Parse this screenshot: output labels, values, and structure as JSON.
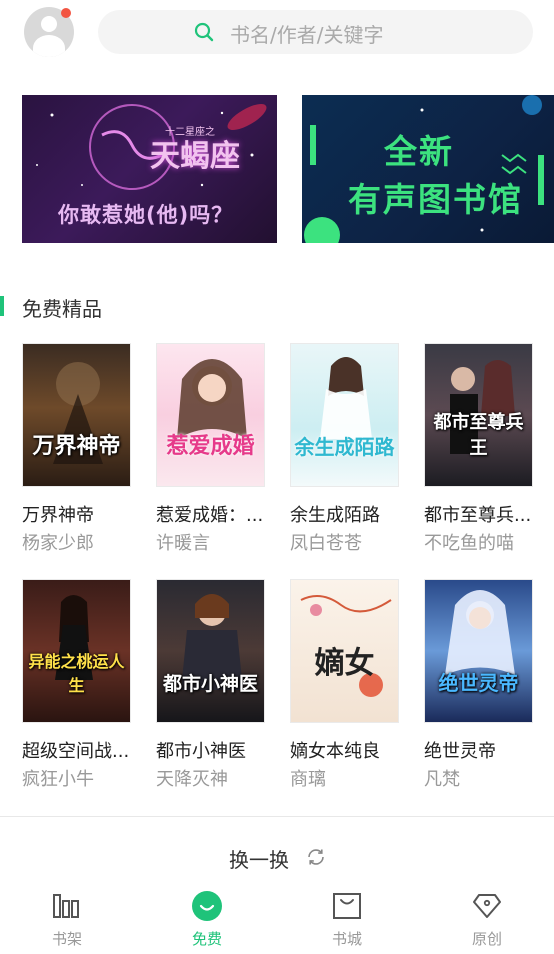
{
  "header": {
    "search_placeholder": "书名/作者/关键字"
  },
  "banners": [
    {
      "small": "十二星座之",
      "title": "天蝎座",
      "subtitle": "你敢惹她(他)吗？"
    },
    {
      "line1": "全新",
      "line2": "有声图书馆"
    }
  ],
  "section": {
    "title": "免费精品"
  },
  "books": [
    {
      "name": "万界神帝",
      "author": "杨家少郎",
      "cover_title": "万界神帝"
    },
    {
      "name": "惹爱成婚：...",
      "author": "许暖言",
      "cover_title": "惹爱成婚"
    },
    {
      "name": "余生成陌路",
      "author": "凤白苍苍",
      "cover_title": "余生成陌路"
    },
    {
      "name": "都市至尊兵...",
      "author": "不吃鱼的喵",
      "cover_title": "都市至尊兵王"
    },
    {
      "name": "超级空间战...",
      "author": "疯狂小牛",
      "cover_title": "异能之桃运人生"
    },
    {
      "name": "都市小神医",
      "author": "天降灭神",
      "cover_title": "都市小神医"
    },
    {
      "name": "嫡女本纯良",
      "author": "商璃",
      "cover_title": "嫡女"
    },
    {
      "name": "绝世灵帝",
      "author": "凡梵",
      "cover_title": "绝世灵帝"
    }
  ],
  "refresh": {
    "label": "换一换"
  },
  "nav": [
    {
      "label": "书架",
      "icon": "bookshelf-icon"
    },
    {
      "label": "免费",
      "icon": "free-icon"
    },
    {
      "label": "书城",
      "icon": "bookstore-icon"
    },
    {
      "label": "原创",
      "icon": "original-icon"
    }
  ],
  "colors": {
    "accent": "#1fc37a",
    "notification": "#f25542",
    "muted_text": "#999999"
  }
}
